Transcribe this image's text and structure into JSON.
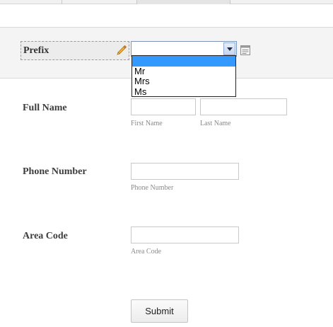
{
  "prefix": {
    "label": "Prefix",
    "selected": "",
    "options": [
      "",
      "Mr",
      "Mrs",
      "Ms"
    ]
  },
  "full_name": {
    "label": "Full Name",
    "first_sublabel": "First Name",
    "last_sublabel": "Last Name",
    "first_value": "",
    "last_value": ""
  },
  "phone": {
    "label": "Phone Number",
    "sublabel": "Phone Number",
    "value": ""
  },
  "area": {
    "label": "Area Code",
    "sublabel": "Area Code",
    "value": ""
  },
  "submit_label": "Submit",
  "icons": {
    "edit": "pencil-icon",
    "options": "options-icon",
    "dropdown": "chevron-down-icon"
  }
}
